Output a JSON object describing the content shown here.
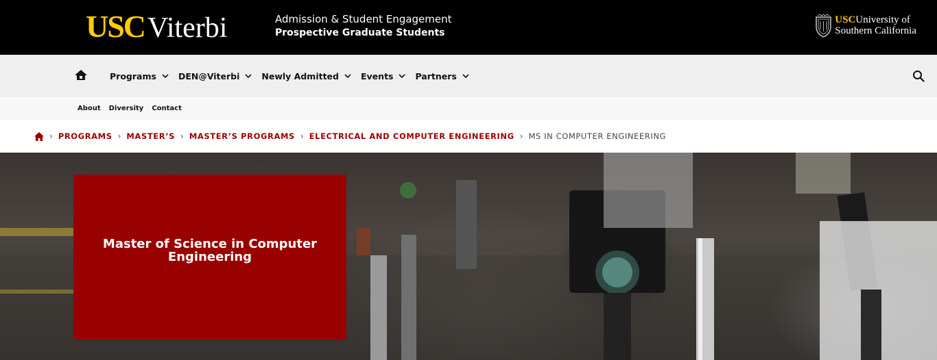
{
  "header": {
    "brand_usc": "USC",
    "brand_viterbi": "Viterbi",
    "dept_line1": "Admission & Student Engagement",
    "dept_line2": "Prospective Graduate Students",
    "univ_usc": "USC",
    "univ_line1": "University of",
    "univ_line2": "Southern California",
    "brand_color": "#ffcc00"
  },
  "nav": {
    "home_icon": "home-icon",
    "items": [
      {
        "label": "Programs"
      },
      {
        "label": "DEN@Viterbi"
      },
      {
        "label": "Newly Admitted"
      },
      {
        "label": "Events"
      },
      {
        "label": "Partners"
      }
    ],
    "search_icon": "search-icon"
  },
  "subnav": {
    "links": [
      {
        "label": "About"
      },
      {
        "label": "Diversity"
      },
      {
        "label": "Contact"
      }
    ]
  },
  "breadcrumb": {
    "items": [
      {
        "label": "PROGRAMS"
      },
      {
        "label": "MASTER’S"
      },
      {
        "label": "MASTER’S PROGRAMS"
      },
      {
        "label": "ELECTRICAL AND COMPUTER ENGINEERING"
      }
    ],
    "current": "MS IN COMPUTER ENGINEERING",
    "accent": "#990000"
  },
  "hero": {
    "title": "Master of Science in Computer Engineering",
    "card_color": "#990000"
  }
}
